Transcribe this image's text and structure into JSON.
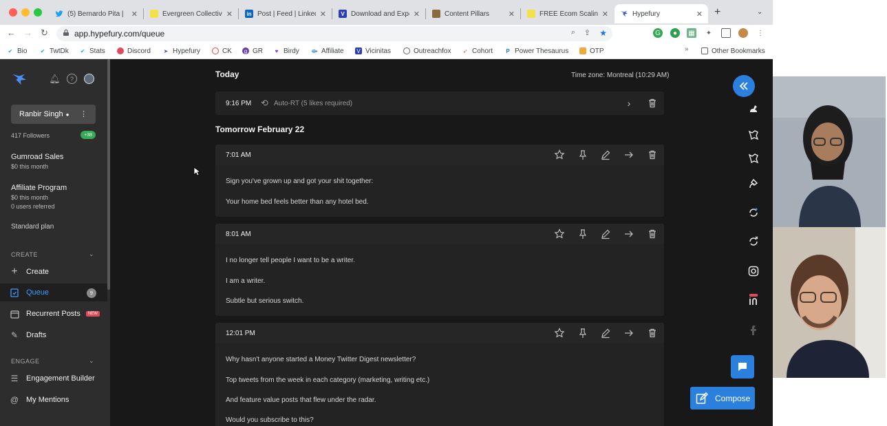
{
  "browser": {
    "tabs": [
      {
        "title": "(5) Bernardo Pita |",
        "icon": "twitter-icon",
        "color": "#1da1f2"
      },
      {
        "title": "Evergreen Collectiv",
        "icon": "evergreen-icon",
        "color": "#f4e04d"
      },
      {
        "title": "Post | Feed | Linked",
        "icon": "linkedin-icon",
        "color": "#0a66c2"
      },
      {
        "title": "Download and Expo",
        "icon": "vicinitas-icon",
        "color": "#2b3fb0"
      },
      {
        "title": "Content Pillars",
        "icon": "notion-icon",
        "color": "#8a6a3a"
      },
      {
        "title": "FREE Ecom Scaling",
        "icon": "evergreen-icon",
        "color": "#f4e04d"
      },
      {
        "title": "Hypefury",
        "icon": "hypefury-icon",
        "color": "#3b5bdb"
      }
    ],
    "url": "app.hypefury.com/queue",
    "bookmarks": [
      "Bio",
      "TwtDk",
      "Stats",
      "Discord",
      "Hypefury",
      "CK",
      "GR",
      "Birdy",
      "Affiliate",
      "Vicinitas",
      "Outreachfox",
      "Cohort",
      "Power Thesaurus",
      "OTP"
    ],
    "other_bookmarks": "Other Bookmarks"
  },
  "sidebar": {
    "user_name": "Ranbir Singh",
    "followers": "417 Followers",
    "followers_badge": "+38",
    "gumroad_title": "Gumroad Sales",
    "gumroad_sub": "$0 this month",
    "affiliate_title": "Affiliate Program",
    "affiliate_sub1": "$0 this month",
    "affiliate_sub2": "0 users referred",
    "plan": "Standard plan",
    "create_section": "CREATE",
    "items": [
      {
        "label": "Create"
      },
      {
        "label": "Queue",
        "count": "9"
      },
      {
        "label": "Recurrent Posts",
        "badge": "NEW"
      },
      {
        "label": "Drafts"
      }
    ],
    "engage_section": "ENGAGE",
    "engage_items": [
      {
        "label": "Engagement Builder"
      },
      {
        "label": "My Mentions"
      }
    ]
  },
  "main": {
    "today_heading": "Today",
    "timezone": "Time zone: Montreal (10:29 AM)",
    "tomorrow_heading": "Tomorrow February 22",
    "auto_rt": {
      "time": "9:16 PM",
      "label": "Auto-RT (5 likes required)"
    },
    "posts": [
      {
        "time": "7:01 AM",
        "lines": [
          "Sign you've grown up and got your shit together:",
          "Your home bed feels better than any hotel bed."
        ]
      },
      {
        "time": "8:01 AM",
        "lines": [
          "I no longer tell people I want to be a writer.",
          "I am a writer.",
          "Subtle but serious switch."
        ]
      },
      {
        "time": "12:01 PM",
        "lines": [
          "Why hasn't anyone started a Money Twitter Digest newsletter?",
          "Top tweets from the week in each category (marketing, writing etc.)",
          "And feature value posts that flew under the radar.",
          "Would you subscribe to this?"
        ]
      }
    ],
    "compose_label": "Compose"
  },
  "colors": {
    "accent": "#2b7fdd",
    "queue_active": "#3d9bff",
    "new_badge": "#e24a5a",
    "followers_badge": "#3aa65a"
  }
}
